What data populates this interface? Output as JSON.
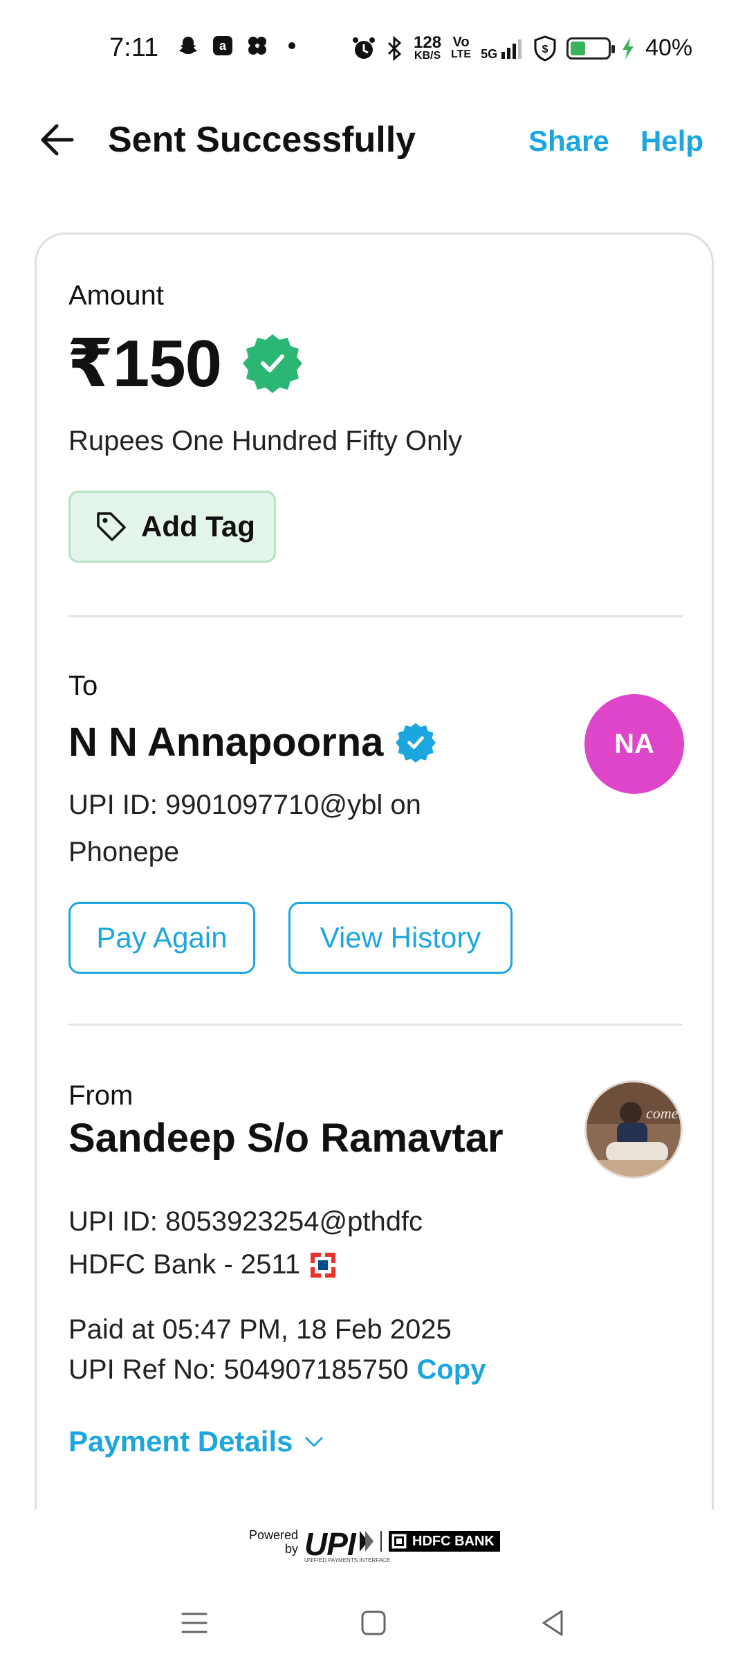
{
  "status_bar": {
    "time": "7:11",
    "net_speed_value": "128",
    "net_speed_unit": "KB/S",
    "volte_top": "Vo",
    "volte_bottom": "LTE",
    "network": "5G",
    "battery_percent": "40%",
    "battery_level": 0.4
  },
  "header": {
    "title": "Sent Successfully",
    "share_label": "Share",
    "help_label": "Help"
  },
  "amount": {
    "label": "Amount",
    "value": "₹150",
    "words": "Rupees One Hundred Fifty Only",
    "add_tag_label": "Add Tag"
  },
  "recipient": {
    "label": "To",
    "name": "N N Annapoorna",
    "upi_line1": "UPI ID: 9901097710@ybl on",
    "upi_line2": "Phonepe",
    "initials": "NA",
    "pay_again_label": "Pay Again",
    "view_history_label": "View History"
  },
  "sender": {
    "label": "From",
    "name": "Sandeep S/o Ramavtar",
    "upi_id": "UPI ID: 8053923254@pthdfc",
    "bank": "HDFC Bank - 2511"
  },
  "transaction": {
    "paid_at": "Paid at 05:47 PM, 18 Feb 2025",
    "ref_no": "UPI Ref No: 504907185750",
    "copy_label": "Copy",
    "payment_details_label": "Payment Details"
  },
  "footer": {
    "powered_line1": "Powered",
    "powered_line2": "by",
    "upi_logo_text": "UPI",
    "upi_logo_sub": "UNIFIED PAYMENTS INTERFACE",
    "bank_logo_text": "HDFC BANK"
  },
  "colors": {
    "accent": "#1ca6e0",
    "verified_green": "#2bb673",
    "verified_blue": "#1ca6e0",
    "avatar_magenta": "#de45c9",
    "tag_bg": "#e4f5e9"
  },
  "icons": [
    "back-arrow-icon",
    "verified-badge-icon",
    "tag-icon",
    "chevron-down-icon",
    "bank-logo-icon"
  ]
}
